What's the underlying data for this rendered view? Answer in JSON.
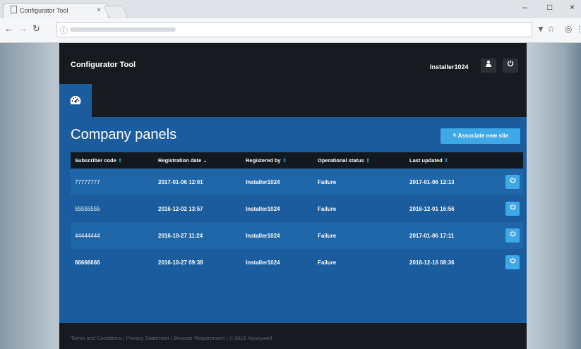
{
  "browser": {
    "tab_title": "Configurator Tool",
    "tab_close": "×",
    "window_controls": {
      "minimize": "–",
      "maximize": "□",
      "close": "×"
    }
  },
  "app": {
    "title": "Configurator Tool",
    "user": "Installer1024",
    "user_icon": "user-icon",
    "logout_icon": "power-icon",
    "dashboard_icon": "dashboard-gauge-icon"
  },
  "main": {
    "title": "Company panels",
    "associate_button": "Associate new site",
    "columns": [
      {
        "label": "Subscriber code",
        "sort": "⇕"
      },
      {
        "label": "Registration date",
        "sort": "⌄"
      },
      {
        "label": "Registered by",
        "sort": "⇕"
      },
      {
        "label": "Operational status",
        "sort": "⇕"
      },
      {
        "label": "Last updated",
        "sort": "⇕"
      }
    ],
    "rows": [
      {
        "code": "77777777",
        "reg_date": "2017-01-06 12:01",
        "registered_by": "Installer1024",
        "status": "Failure",
        "last_updated": "2017-01-06 12:13"
      },
      {
        "code": "55555555",
        "reg_date": "2016-12-02 13:57",
        "registered_by": "Installer1024",
        "status": "Failure",
        "last_updated": "2016-12-01 16:56"
      },
      {
        "code": "44444444",
        "reg_date": "2016-10-27 11:24",
        "registered_by": "Installer1024",
        "status": "Failure",
        "last_updated": "2017-01-06 17:11"
      },
      {
        "code": "66666666",
        "reg_date": "2016-10-27 09:38",
        "registered_by": "Installer1024",
        "status": "Failure",
        "last_updated": "2016-12-16 08:36"
      }
    ]
  },
  "footer": {
    "text": "Terms and Conditions | Privacy Statement | Browser Requirement | © 2016 Honeywell"
  },
  "colors": {
    "topbar": "#171b20",
    "panel": "#1a5c9d",
    "accent": "#3fa9e8"
  }
}
